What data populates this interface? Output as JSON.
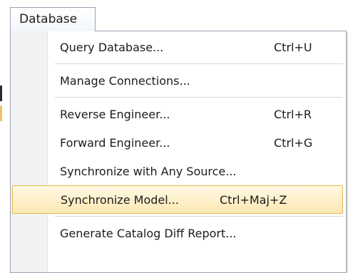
{
  "menu": {
    "title": "Database",
    "items": [
      {
        "label": "Query Database...",
        "shortcut": "Ctrl+U"
      },
      {
        "label": "Manage Connections...",
        "shortcut": ""
      },
      {
        "label": "Reverse Engineer...",
        "shortcut": "Ctrl+R"
      },
      {
        "label": "Forward Engineer...",
        "shortcut": "Ctrl+G"
      },
      {
        "label": "Synchronize with Any Source...",
        "shortcut": ""
      },
      {
        "label": "Synchronize Model...",
        "shortcut": "Ctrl+Maj+Z",
        "highlighted": true
      },
      {
        "label": "Generate Catalog Diff Report...",
        "shortcut": ""
      }
    ]
  },
  "colors": {
    "highlight_background": "#fde8b4",
    "highlight_border": "#e4b94e",
    "menu_border": "#9aa4b5",
    "gutter": "#f1f2f4"
  }
}
